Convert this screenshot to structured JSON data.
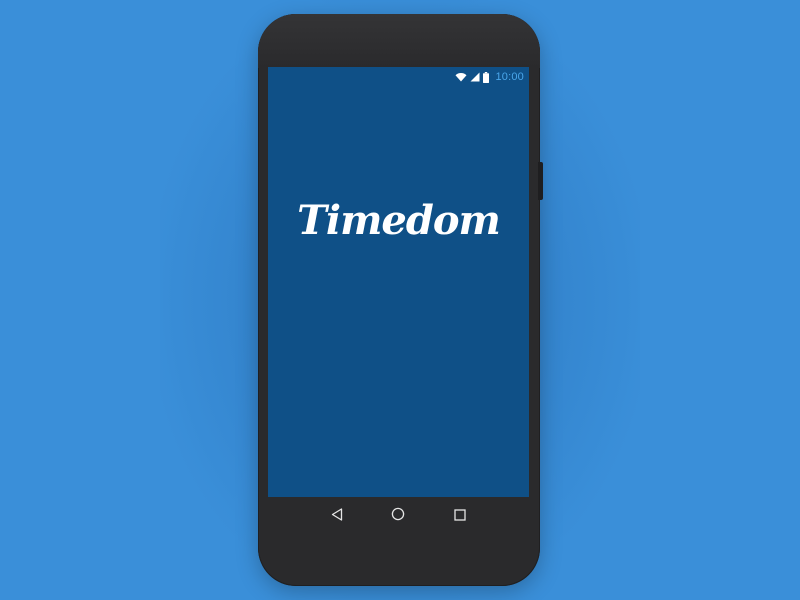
{
  "app": {
    "name": "Timedom"
  },
  "status_bar": {
    "time": "10:00",
    "icons": [
      "wifi-icon",
      "signal-icon",
      "battery-icon"
    ],
    "time_color": "#4aa6ea"
  },
  "navigation": {
    "buttons": [
      "back-icon",
      "home-icon",
      "recents-icon"
    ]
  },
  "colors": {
    "background": "#3a8fd9",
    "screen": "#0f5087",
    "phone_body": "#2a2a2c",
    "logo_text": "#ffffff",
    "nav_icons": "#e6e6e6"
  }
}
